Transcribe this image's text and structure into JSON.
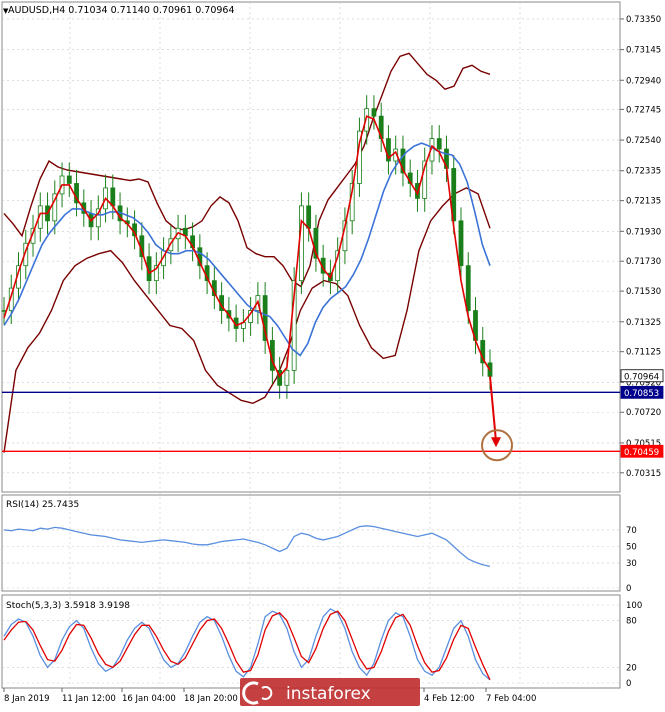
{
  "header": {
    "symbol_line": "AUDUSD,H4  0.71034 0.71140 0.70961 0.70964"
  },
  "colors": {
    "candle": "#1a7f1a",
    "ma_fast": "#e00000",
    "ma_slow": "#3b73d8",
    "bollinger": "#7a0000",
    "support_line": "#00008b",
    "target_line": "#ff0000",
    "rsi_line": "#5a8fe0",
    "stoch_main": "#5a8fe0",
    "stoch_signal": "#e00000",
    "grid": "#c8c8c8",
    "arrow": "#e00000",
    "target_circle": "#b07040",
    "watermark_bg": "#c03030"
  },
  "chart_data": [
    {
      "name": "price",
      "type": "line",
      "title": "AUDUSD,H4",
      "ohlc_header": {
        "open": 0.71034,
        "high": 0.7114,
        "low": 0.70961,
        "close": 0.70964
      },
      "ylim": [
        0.702,
        0.7345
      ],
      "yticks": [
        "0.73350",
        "0.73145",
        "0.72940",
        "0.72745",
        "0.72540",
        "0.72335",
        "0.72135",
        "0.71930",
        "0.71730",
        "0.71530",
        "0.71325",
        "0.71125",
        "0.70920",
        "0.70720",
        "0.70515",
        "0.70315"
      ],
      "xticks": [
        "8 Jan 2019",
        "11 Jan 12:00",
        "16 Jan 04:00",
        "18 Jan 20:00",
        "4 Feb 12:00",
        "7 Feb 04:00"
      ],
      "price_labels": [
        {
          "label": "0.70964",
          "value": 0.70964,
          "style": "current"
        },
        {
          "label": "0.70853",
          "value": 0.70853,
          "style": "support"
        },
        {
          "label": "0.70459",
          "value": 0.70459,
          "style": "target"
        }
      ],
      "close_series": [
        0.714,
        0.7155,
        0.717,
        0.7185,
        0.7195,
        0.721,
        0.72,
        0.7218,
        0.723,
        0.7225,
        0.7212,
        0.7205,
        0.7196,
        0.7208,
        0.7222,
        0.721,
        0.72,
        0.7198,
        0.719,
        0.7176,
        0.716,
        0.717,
        0.718,
        0.7188,
        0.7195,
        0.719,
        0.7182,
        0.717,
        0.716,
        0.715,
        0.714,
        0.7135,
        0.7128,
        0.7132,
        0.714,
        0.715,
        0.712,
        0.71,
        0.709,
        0.71,
        0.716,
        0.721,
        0.7195,
        0.7175,
        0.7165,
        0.716,
        0.718,
        0.72,
        0.7225,
        0.726,
        0.7275,
        0.727,
        0.7255,
        0.724,
        0.7248,
        0.7232,
        0.7225,
        0.7215,
        0.724,
        0.7255,
        0.7248,
        0.7235,
        0.72,
        0.717,
        0.714,
        0.712,
        0.7105,
        0.7096
      ],
      "ma_fast": [
        0.7135,
        0.715,
        0.7166,
        0.718,
        0.7192,
        0.7205,
        0.7205,
        0.7214,
        0.7224,
        0.7224,
        0.7215,
        0.7208,
        0.72,
        0.7205,
        0.7215,
        0.721,
        0.7202,
        0.7198,
        0.7192,
        0.718,
        0.7165,
        0.7168,
        0.7176,
        0.7185,
        0.7192,
        0.719,
        0.7183,
        0.7172,
        0.7162,
        0.7152,
        0.7143,
        0.7137,
        0.713,
        0.7132,
        0.7138,
        0.7146,
        0.7126,
        0.7106,
        0.7096,
        0.7102,
        0.715,
        0.72,
        0.7195,
        0.7178,
        0.7168,
        0.7162,
        0.7176,
        0.7196,
        0.722,
        0.7252,
        0.727,
        0.7268,
        0.7256,
        0.7242,
        0.7246,
        0.7234,
        0.7226,
        0.7218,
        0.7236,
        0.725,
        0.7246,
        0.7236,
        0.7196,
        0.716,
        0.7136,
        0.712,
        0.7108,
        0.71
      ],
      "ma_slow": [
        0.713,
        0.7138,
        0.7148,
        0.716,
        0.7172,
        0.7184,
        0.7192,
        0.7198,
        0.7204,
        0.7208,
        0.7208,
        0.7206,
        0.7204,
        0.7204,
        0.7206,
        0.7206,
        0.7204,
        0.7202,
        0.7198,
        0.7192,
        0.7184,
        0.718,
        0.7178,
        0.7178,
        0.718,
        0.718,
        0.7178,
        0.7174,
        0.7168,
        0.7162,
        0.7156,
        0.715,
        0.7144,
        0.714,
        0.7138,
        0.7136,
        0.713,
        0.7122,
        0.7114,
        0.711,
        0.7118,
        0.7132,
        0.7142,
        0.7148,
        0.7152,
        0.7156,
        0.7164,
        0.7174,
        0.7188,
        0.7204,
        0.722,
        0.7232,
        0.724,
        0.7246,
        0.725,
        0.7252,
        0.725,
        0.7247,
        0.7245,
        0.7244,
        0.7238,
        0.7226,
        0.7206,
        0.7184,
        0.717
      ],
      "bb_upper": [
        0.7205,
        0.7198,
        0.719,
        0.721,
        0.7228,
        0.724,
        0.7236,
        0.7234,
        0.7233,
        0.7232,
        0.7231,
        0.723,
        0.7229,
        0.7228,
        0.7227,
        0.7228,
        0.7226,
        0.7212,
        0.72,
        0.7195,
        0.7194,
        0.7196,
        0.72,
        0.721,
        0.7216,
        0.7212,
        0.72,
        0.7182,
        0.7178,
        0.7176,
        0.7176,
        0.717,
        0.716,
        0.7156,
        0.717,
        0.72,
        0.7214,
        0.7222,
        0.723,
        0.7238,
        0.725,
        0.7268,
        0.7284,
        0.73,
        0.731,
        0.7312,
        0.7305,
        0.7298,
        0.7294,
        0.7288,
        0.729,
        0.7302,
        0.7304,
        0.73,
        0.7298
      ],
      "bb_lower": [
        0.7045,
        0.71,
        0.7115,
        0.7125,
        0.714,
        0.716,
        0.717,
        0.7175,
        0.7178,
        0.718,
        0.7172,
        0.716,
        0.715,
        0.714,
        0.713,
        0.7128,
        0.712,
        0.71,
        0.709,
        0.7085,
        0.708,
        0.7078,
        0.7082,
        0.7095,
        0.7115,
        0.714,
        0.7155,
        0.716,
        0.7158,
        0.715,
        0.713,
        0.7115,
        0.7108,
        0.711,
        0.714,
        0.718,
        0.72,
        0.721,
        0.7218,
        0.7222,
        0.7218,
        0.7195
      ],
      "support_level": 0.70853,
      "target_level": 0.70459
    },
    {
      "name": "rsi",
      "type": "line",
      "title": "RSI(14) 25.7435",
      "ylim": [
        0,
        100
      ],
      "yticks": [
        "70",
        "50",
        "30",
        "0"
      ],
      "values": [
        70,
        69,
        71,
        70,
        69,
        72,
        71,
        73,
        72,
        70,
        68,
        66,
        64,
        63,
        62,
        60,
        58,
        57,
        56,
        55,
        56,
        57,
        58,
        57,
        56,
        55,
        53,
        52,
        52,
        54,
        56,
        57,
        58,
        59,
        57,
        55,
        52,
        48,
        44,
        48,
        62,
        66,
        64,
        60,
        58,
        60,
        62,
        66,
        70,
        74,
        75,
        74,
        72,
        70,
        68,
        66,
        64,
        62,
        64,
        66,
        62,
        58,
        50,
        42,
        35,
        31,
        28,
        26
      ]
    },
    {
      "name": "stochastic",
      "type": "line",
      "title": "Stoch(5,3,3) 3.5918 3.9198",
      "ylim": [
        0,
        100
      ],
      "yticks": [
        "100",
        "80",
        "20",
        "0"
      ],
      "main": [
        60,
        75,
        82,
        78,
        60,
        35,
        20,
        30,
        55,
        72,
        80,
        70,
        45,
        25,
        15,
        20,
        35,
        55,
        70,
        78,
        70,
        50,
        30,
        20,
        25,
        40,
        60,
        78,
        85,
        80,
        60,
        35,
        15,
        8,
        20,
        50,
        85,
        92,
        88,
        70,
        40,
        20,
        30,
        60,
        85,
        95,
        90,
        70,
        40,
        20,
        10,
        25,
        55,
        80,
        90,
        85,
        60,
        30,
        15,
        10,
        20,
        45,
        70,
        80,
        60,
        30,
        12,
        4
      ],
      "signal": [
        55,
        68,
        78,
        79,
        68,
        48,
        30,
        28,
        42,
        62,
        75,
        74,
        58,
        38,
        24,
        20,
        28,
        45,
        62,
        74,
        74,
        60,
        42,
        28,
        24,
        32,
        50,
        68,
        80,
        82,
        70,
        50,
        28,
        14,
        16,
        36,
        68,
        86,
        90,
        80,
        58,
        34,
        26,
        44,
        70,
        88,
        92,
        80,
        56,
        32,
        18,
        20,
        40,
        66,
        84,
        88,
        74,
        48,
        26,
        14,
        16,
        32,
        56,
        74,
        70,
        46,
        24,
        4
      ]
    }
  ],
  "watermark": {
    "text": "instaforex"
  }
}
